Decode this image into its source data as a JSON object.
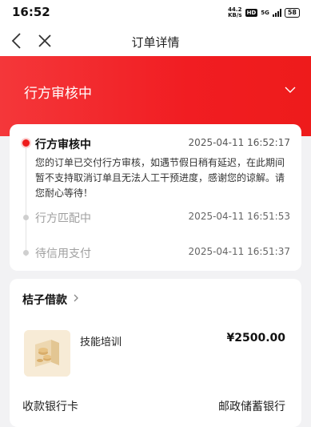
{
  "status_bar": {
    "time": "16:52",
    "net_speed_value": "44.2",
    "net_speed_unit": "KB/s",
    "hd_badge": "HD",
    "signal_label": "5G",
    "battery": "58"
  },
  "nav": {
    "title": "订单详情",
    "back_icon": "chevron-left-icon",
    "close_icon": "close-icon"
  },
  "hero": {
    "status": "行方审核中",
    "expand_icon": "chevron-down-icon",
    "color": "#f11d22"
  },
  "timeline": [
    {
      "title": "行方审核中",
      "time": "2025-04-11 16:52:17",
      "description": "您的订单已交付行方审核，如遇节假日稍有延迟，在此期间暂不支持取消订单且无法人工干预进度，感谢您的谅解。请您耐心等待！"
    },
    {
      "title": "行方匹配中",
      "time": "2025-04-11 16:51:53"
    },
    {
      "title": "待信用支付",
      "time": "2025-04-11 16:51:37"
    }
  ],
  "loan": {
    "lender": "桔子借款",
    "item_name": "技能培训",
    "price": "¥2500.00",
    "bank_label": "收款银行卡",
    "bank_value": "邮政储蓄银行"
  }
}
